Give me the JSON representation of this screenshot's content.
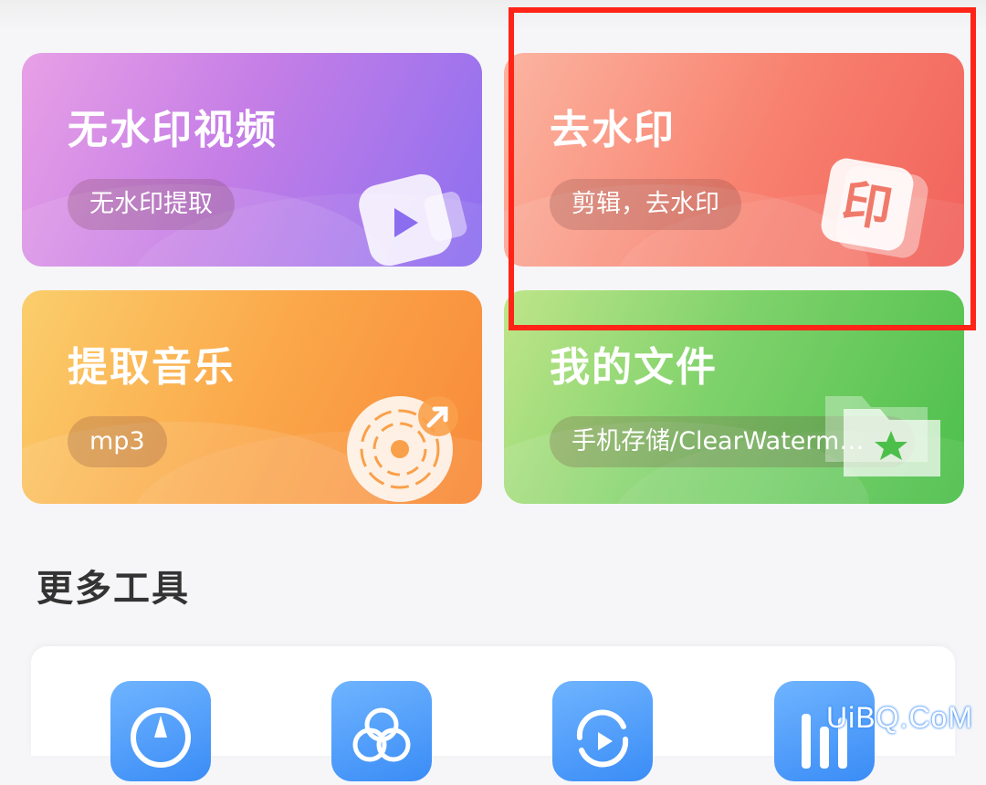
{
  "cards": [
    {
      "id": "video",
      "title": "无水印视频",
      "subtitle": "无水印提取",
      "icon": "video-camera-icon"
    },
    {
      "id": "watermark",
      "title": "去水印",
      "subtitle": "剪辑，去水印",
      "icon": "stamp-icon",
      "icon_glyph": "印"
    },
    {
      "id": "music",
      "title": "提取音乐",
      "subtitle": "mp3",
      "icon": "vinyl-disc-icon"
    },
    {
      "id": "files",
      "title": "我的文件",
      "subtitle": "手机存储/ClearWaterm…",
      "icon": "folder-star-icon"
    }
  ],
  "section": {
    "title": "更多工具"
  },
  "tools": [
    {
      "icon": "compass-icon"
    },
    {
      "icon": "filter-circles-icon"
    },
    {
      "icon": "refresh-play-icon"
    },
    {
      "icon": "bars-icon"
    }
  ],
  "watermark": {
    "text": "UiBQ.CoM"
  },
  "colors": {
    "highlight": "#ff2417",
    "tool_blue": "#3a8cf6"
  }
}
